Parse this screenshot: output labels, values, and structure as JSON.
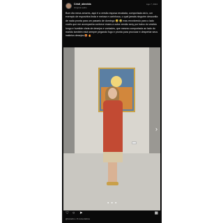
{
  "post": {
    "username": "Cristi_almeida",
    "subline": "Original audio",
    "date": "Ago 7, 2024",
    "caption": "Bom dia meus amores, aqui é a versão esposa recatada, comportada da lo, um exemplo de esposinha linda e meiosa e carinhosa, o qual jamais ninguém desconfia de nada pronta para um passeio de domingo 😅 🤣 mas envolvendo para o lado vocês que me acompanha conhece esses a outra versão sexy por baixo do vestido longo e humilde cheia de desejos e vontades, que mesmo comportada ao lado do marido também está sempre pegando fogo e pronta para provocar e despertar seus instintos desejos 🥵 🔥",
    "footer": "@lucasbo • 8 comentários"
  },
  "icons": {
    "next": "chevron-right-icon",
    "heart": "heart-icon",
    "comment": "comment-icon",
    "share": "share-icon",
    "save": "bookmark-icon"
  },
  "carousel": {
    "indicator": "● ● ●"
  },
  "colors": {
    "background": "#0a0a0a",
    "text": "#e4e4e4",
    "muted": "#9a9a9a"
  }
}
